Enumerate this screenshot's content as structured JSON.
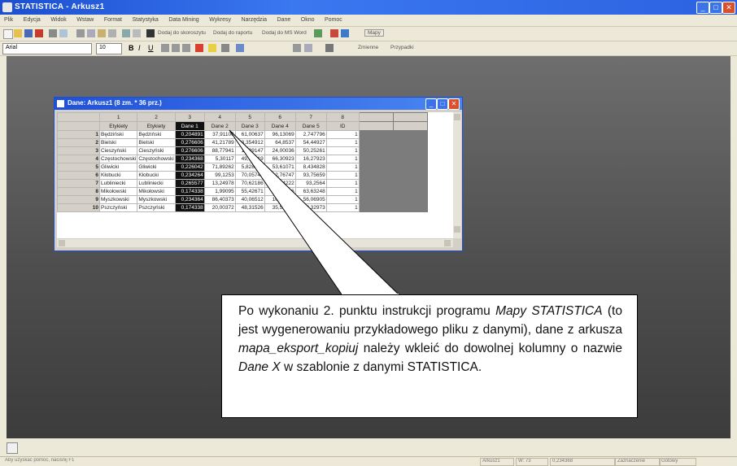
{
  "app": {
    "title": "STATISTICA - Arkusz1"
  },
  "menu": [
    "Plik",
    "Edycja",
    "Widok",
    "Wstaw",
    "Format",
    "Statystyka",
    "Data Mining",
    "Wykresy",
    "Narzędzia",
    "Dane",
    "Okno",
    "Pomoc"
  ],
  "toolbar": {
    "font": "Arial",
    "font_size": "10",
    "add_to_report": "Dodaj do skoroszytu",
    "add_to_report2": "Dodaj do raportu",
    "add_to_word": "Dodaj do MS Word",
    "maps": "Mapy",
    "zoom": "Zmienne",
    "cases": "Przypadki"
  },
  "spreadsheet": {
    "title": "Dane: Arkusz1 (8 zm. * 36 prz.)",
    "col_numbers": [
      "1",
      "2",
      "3",
      "4",
      "5",
      "6",
      "7",
      "8"
    ],
    "columns": [
      "Etykiety",
      "Etykiety",
      "Dane 1",
      "Dane 2",
      "Dane 3",
      "Dane 4",
      "Dane 5",
      "ID"
    ],
    "rows": [
      [
        "1",
        "Będziński",
        "Będziński",
        "0,204891",
        "37,91106",
        "61,00637",
        "96,13069",
        "2,747796",
        "1"
      ],
      [
        "2",
        "Bielski",
        "Bielski",
        "0,276606",
        "41,21789",
        "3,354912",
        "64,8537",
        "54,44927",
        "1"
      ],
      [
        "3",
        "Cieszyński",
        "Cieszyński",
        "0,276606",
        "88,77941",
        "12,09147",
        "24,00036",
        "50,25261",
        "1"
      ],
      [
        "4",
        "Częstochowski",
        "Częstochowski",
        "0,234368",
        "5,30117",
        "49,80019",
        "66,30923",
        "16,27923",
        "1"
      ],
      [
        "5",
        "Gliwicki",
        "Gliwicki",
        "0,226042",
        "71,89262",
        "5,828363",
        "53,61071",
        "8,434828",
        "1"
      ],
      [
        "6",
        "Kłobucki",
        "Kłobucki",
        "0,234264",
        "99,1253",
        "70,05749",
        "12,76747",
        "93,75659",
        "1"
      ],
      [
        "7",
        "Lubliniecki",
        "Lubliniecki",
        "0,265577",
        "13,24978",
        "70,62186",
        "29,94222",
        "93,2564",
        "1"
      ],
      [
        "8",
        "Mikołowski",
        "Mikołowski",
        "0,174338",
        "1,99095",
        "55,42671",
        "14,33616",
        "63,63248",
        "1"
      ],
      [
        "9",
        "Myszkowski",
        "Myszkowski",
        "0,234364",
        "86,40373",
        "40,06512",
        "10,13141",
        "56,06905",
        "1"
      ],
      [
        "10",
        "Pszczyński",
        "Pszczyński",
        "0,174338",
        "20,00372",
        "48,31526",
        "35,52341",
        "32,32973",
        "1"
      ]
    ]
  },
  "callout": {
    "t1": "Po wykonaniu 2. punktu instrukcji programu ",
    "t2": "Mapy STATISTICA",
    "t3": " (to jest wygenerowaniu przykładowego pliku z danymi), dane z arkusza ",
    "t4": "mapa_eksport_kopiuj",
    "t5": " należy wkleić do dowolnej kolumny o nazwie ",
    "t6": "Dane X",
    "t7": " w szablonie z danymi STATISTICA."
  },
  "status": {
    "left": "Aby uzyskać pomoc, naciśnij F1",
    "mode": "Arkusz1",
    "pos": "W: 73",
    "value": "0,234368",
    "sel": "Zaznaczenie",
    "state": "Gotowy"
  },
  "colors": {
    "titlebar": "#2d62e0",
    "selection": "#111111",
    "workspace": "#5a5a5a"
  }
}
